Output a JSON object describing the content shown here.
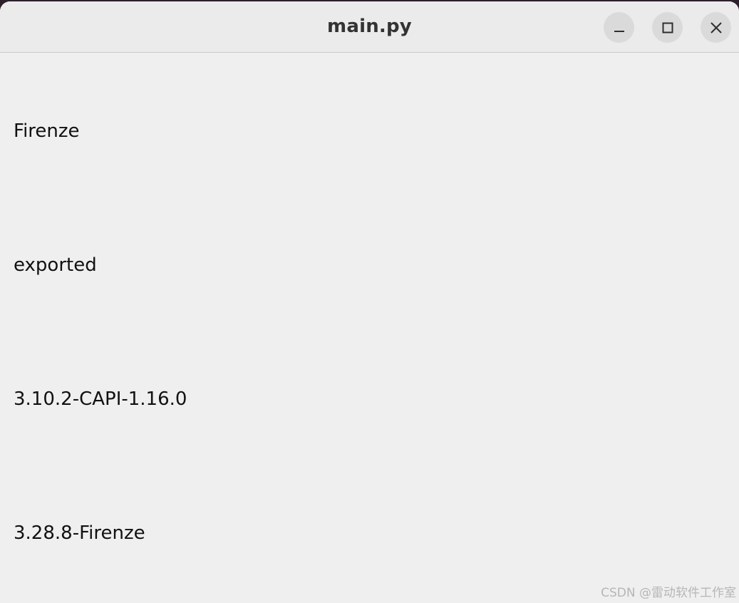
{
  "window": {
    "title": "main.py",
    "controls": {
      "minimize_icon": "minimize-icon",
      "maximize_icon": "maximize-icon",
      "close_icon": "close-icon"
    }
  },
  "content": {
    "labels": [
      "Firenze",
      "exported",
      "3.10.2-CAPI-1.16.0",
      "3.28.8-Firenze"
    ]
  },
  "watermark": "CSDN @雷动软件工作室",
  "colors": {
    "window_bg": "#efefef",
    "titlebar_bg": "#ebebeb",
    "control_bg": "#dadada",
    "text": "#111111"
  }
}
